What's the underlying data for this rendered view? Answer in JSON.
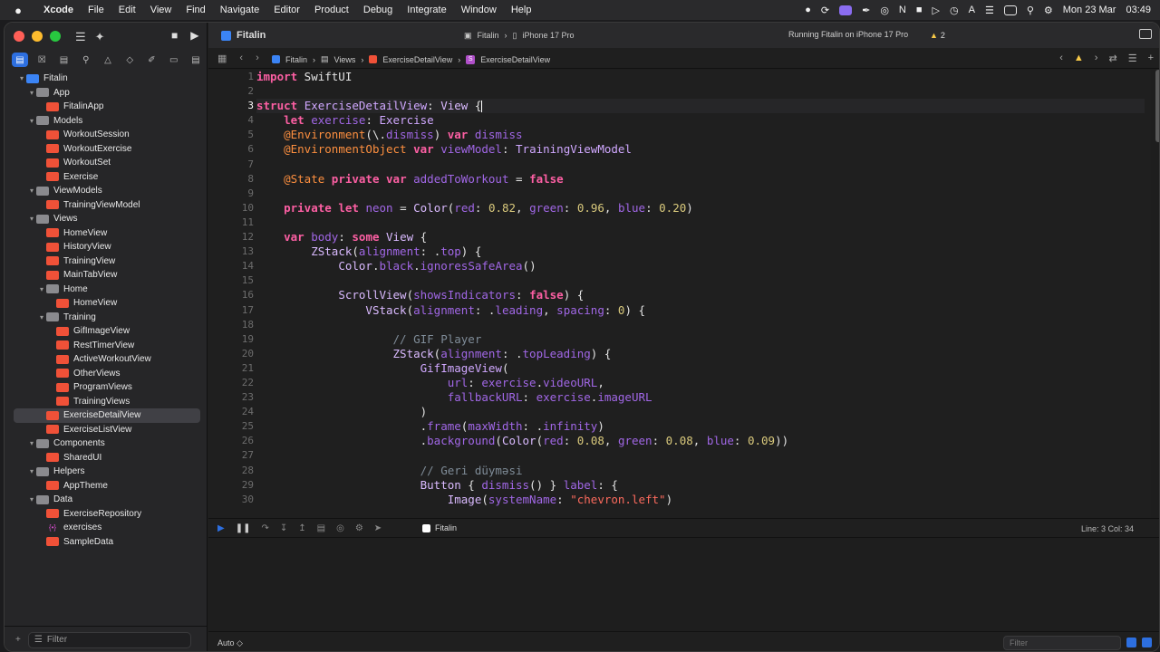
{
  "menubar": {
    "apple": "",
    "app": "Xcode",
    "items": [
      "File",
      "Edit",
      "View",
      "Find",
      "Navigate",
      "Editor",
      "Product",
      "Debug",
      "Integrate",
      "Window",
      "Help"
    ],
    "date": "Mon 23 Mar",
    "time": "03:49"
  },
  "toolbar": {
    "project": "Fitalin",
    "scheme": "Fitalin",
    "device": "iPhone 17 Pro",
    "status": "Running Fitalin on iPhone 17 Pro",
    "warning_count": "2"
  },
  "jumpbar": {
    "crumbs": [
      "Fitalin",
      "Views",
      "ExerciseDetailView",
      "ExerciseDetailView"
    ]
  },
  "navigator": {
    "items": [
      {
        "label": "Fitalin",
        "kind": "proj",
        "depth": 0,
        "chev": "▾"
      },
      {
        "label": "App",
        "kind": "folder",
        "depth": 1,
        "chev": "▾"
      },
      {
        "label": "FitalinApp",
        "kind": "swift",
        "depth": 2,
        "chev": ""
      },
      {
        "label": "Models",
        "kind": "folder",
        "depth": 1,
        "chev": "▾"
      },
      {
        "label": "WorkoutSession",
        "kind": "swift",
        "depth": 2,
        "chev": ""
      },
      {
        "label": "WorkoutExercise",
        "kind": "swift",
        "depth": 2,
        "chev": ""
      },
      {
        "label": "WorkoutSet",
        "kind": "swift",
        "depth": 2,
        "chev": ""
      },
      {
        "label": "Exercise",
        "kind": "swift",
        "depth": 2,
        "chev": ""
      },
      {
        "label": "ViewModels",
        "kind": "folder",
        "depth": 1,
        "chev": "▾"
      },
      {
        "label": "TrainingViewModel",
        "kind": "swift",
        "depth": 2,
        "chev": ""
      },
      {
        "label": "Views",
        "kind": "folder",
        "depth": 1,
        "chev": "▾"
      },
      {
        "label": "HomeView",
        "kind": "swift",
        "depth": 2,
        "chev": ""
      },
      {
        "label": "HistoryView",
        "kind": "swift",
        "depth": 2,
        "chev": ""
      },
      {
        "label": "TrainingView",
        "kind": "swift",
        "depth": 2,
        "chev": ""
      },
      {
        "label": "MainTabView",
        "kind": "swift",
        "depth": 2,
        "chev": ""
      },
      {
        "label": "Home",
        "kind": "folder",
        "depth": 2,
        "chev": "▾"
      },
      {
        "label": "HomeView",
        "kind": "swift",
        "depth": 3,
        "chev": ""
      },
      {
        "label": "Training",
        "kind": "folder",
        "depth": 2,
        "chev": "▾"
      },
      {
        "label": "GifImageView",
        "kind": "swift",
        "depth": 3,
        "chev": ""
      },
      {
        "label": "RestTimerView",
        "kind": "swift",
        "depth": 3,
        "chev": ""
      },
      {
        "label": "ActiveWorkoutView",
        "kind": "swift",
        "depth": 3,
        "chev": ""
      },
      {
        "label": "OtherViews",
        "kind": "swift",
        "depth": 3,
        "chev": ""
      },
      {
        "label": "ProgramViews",
        "kind": "swift",
        "depth": 3,
        "chev": ""
      },
      {
        "label": "TrainingViews",
        "kind": "swift",
        "depth": 3,
        "chev": ""
      },
      {
        "label": "ExerciseDetailView",
        "kind": "swift",
        "depth": 2,
        "chev": "",
        "selected": true
      },
      {
        "label": "ExerciseListView",
        "kind": "swift",
        "depth": 2,
        "chev": ""
      },
      {
        "label": "Components",
        "kind": "folder",
        "depth": 1,
        "chev": "▾"
      },
      {
        "label": "SharedUI",
        "kind": "swift",
        "depth": 2,
        "chev": ""
      },
      {
        "label": "Helpers",
        "kind": "folder",
        "depth": 1,
        "chev": "▾"
      },
      {
        "label": "AppTheme",
        "kind": "swift",
        "depth": 2,
        "chev": ""
      },
      {
        "label": "Data",
        "kind": "folder",
        "depth": 1,
        "chev": "▾"
      },
      {
        "label": "ExerciseRepository",
        "kind": "swift",
        "depth": 2,
        "chev": ""
      },
      {
        "label": "exercises",
        "kind": "json",
        "depth": 2,
        "chev": ""
      },
      {
        "label": "SampleData",
        "kind": "swift",
        "depth": 2,
        "chev": ""
      }
    ],
    "filter_placeholder": "Filter"
  },
  "editor": {
    "current_line": 3,
    "lines": [
      [
        [
          "kw",
          "import"
        ],
        [
          "t",
          " SwiftUI"
        ]
      ],
      [],
      [
        [
          "kw",
          "struct"
        ],
        [
          "t",
          " "
        ],
        [
          "ty",
          "ExerciseDetailView"
        ],
        [
          "t",
          ": "
        ],
        [
          "pt",
          "View"
        ],
        [
          "t",
          " {"
        ]
      ],
      [
        [
          "t",
          "    "
        ],
        [
          "kw",
          "let"
        ],
        [
          "t",
          " "
        ],
        [
          "pr",
          "exercise"
        ],
        [
          "t",
          ": "
        ],
        [
          "ty",
          "Exercise"
        ]
      ],
      [
        [
          "t",
          "    "
        ],
        [
          "at",
          "@Environment"
        ],
        [
          "t",
          "(\\."
        ],
        [
          "pr",
          "dismiss"
        ],
        [
          "t",
          ") "
        ],
        [
          "kw",
          "var"
        ],
        [
          "t",
          " "
        ],
        [
          "pr",
          "dismiss"
        ]
      ],
      [
        [
          "t",
          "    "
        ],
        [
          "at",
          "@EnvironmentObject"
        ],
        [
          "t",
          " "
        ],
        [
          "kw",
          "var"
        ],
        [
          "t",
          " "
        ],
        [
          "pr",
          "viewModel"
        ],
        [
          "t",
          ": "
        ],
        [
          "ty",
          "TrainingViewModel"
        ]
      ],
      [],
      [
        [
          "t",
          "    "
        ],
        [
          "at",
          "@State"
        ],
        [
          "t",
          " "
        ],
        [
          "kw",
          "private"
        ],
        [
          "t",
          " "
        ],
        [
          "kw",
          "var"
        ],
        [
          "t",
          " "
        ],
        [
          "pr",
          "addedToWorkout"
        ],
        [
          "t",
          " = "
        ],
        [
          "kw",
          "false"
        ]
      ],
      [],
      [
        [
          "t",
          "    "
        ],
        [
          "kw",
          "private"
        ],
        [
          "t",
          " "
        ],
        [
          "kw",
          "let"
        ],
        [
          "t",
          " "
        ],
        [
          "pr",
          "neon"
        ],
        [
          "t",
          " = "
        ],
        [
          "pt",
          "Color"
        ],
        [
          "t",
          "("
        ],
        [
          "pr",
          "red"
        ],
        [
          "t",
          ": "
        ],
        [
          "nu",
          "0.82"
        ],
        [
          "t",
          ", "
        ],
        [
          "pr",
          "green"
        ],
        [
          "t",
          ": "
        ],
        [
          "nu",
          "0.96"
        ],
        [
          "t",
          ", "
        ],
        [
          "pr",
          "blue"
        ],
        [
          "t",
          ": "
        ],
        [
          "nu",
          "0.20"
        ],
        [
          "t",
          ")"
        ]
      ],
      [],
      [
        [
          "t",
          "    "
        ],
        [
          "kw",
          "var"
        ],
        [
          "t",
          " "
        ],
        [
          "pr",
          "body"
        ],
        [
          "t",
          ": "
        ],
        [
          "kw",
          "some"
        ],
        [
          "t",
          " "
        ],
        [
          "pt",
          "View"
        ],
        [
          "t",
          " {"
        ]
      ],
      [
        [
          "t",
          "        "
        ],
        [
          "pt",
          "ZStack"
        ],
        [
          "t",
          "("
        ],
        [
          "pr",
          "alignment"
        ],
        [
          "t",
          ": ."
        ],
        [
          "pr",
          "top"
        ],
        [
          "t",
          ") {"
        ]
      ],
      [
        [
          "t",
          "            "
        ],
        [
          "pt",
          "Color"
        ],
        [
          "t",
          "."
        ],
        [
          "pr",
          "black"
        ],
        [
          "t",
          "."
        ],
        [
          "pr",
          "ignoresSafeArea"
        ],
        [
          "t",
          "()"
        ]
      ],
      [],
      [
        [
          "t",
          "            "
        ],
        [
          "pt",
          "ScrollView"
        ],
        [
          "t",
          "("
        ],
        [
          "pr",
          "showsIndicators"
        ],
        [
          "t",
          ": "
        ],
        [
          "kw",
          "false"
        ],
        [
          "t",
          ") {"
        ]
      ],
      [
        [
          "t",
          "                "
        ],
        [
          "pt",
          "VStack"
        ],
        [
          "t",
          "("
        ],
        [
          "pr",
          "alignment"
        ],
        [
          "t",
          ": ."
        ],
        [
          "pr",
          "leading"
        ],
        [
          "t",
          ", "
        ],
        [
          "pr",
          "spacing"
        ],
        [
          "t",
          ": "
        ],
        [
          "nu",
          "0"
        ],
        [
          "t",
          ") {"
        ]
      ],
      [],
      [
        [
          "t",
          "                    "
        ],
        [
          "cm",
          "// GIF Player"
        ]
      ],
      [
        [
          "t",
          "                    "
        ],
        [
          "pt",
          "ZStack"
        ],
        [
          "t",
          "("
        ],
        [
          "pr",
          "alignment"
        ],
        [
          "t",
          ": ."
        ],
        [
          "pr",
          "topLeading"
        ],
        [
          "t",
          ") {"
        ]
      ],
      [
        [
          "t",
          "                        "
        ],
        [
          "ty",
          "GifImageView"
        ],
        [
          "t",
          "("
        ]
      ],
      [
        [
          "t",
          "                            "
        ],
        [
          "pr",
          "url"
        ],
        [
          "t",
          ": "
        ],
        [
          "pr",
          "exercise"
        ],
        [
          "t",
          "."
        ],
        [
          "pr",
          "videoURL"
        ],
        [
          "t",
          ","
        ]
      ],
      [
        [
          "t",
          "                            "
        ],
        [
          "pr",
          "fallbackURL"
        ],
        [
          "t",
          ": "
        ],
        [
          "pr",
          "exercise"
        ],
        [
          "t",
          "."
        ],
        [
          "pr",
          "imageURL"
        ]
      ],
      [
        [
          "t",
          "                        )"
        ]
      ],
      [
        [
          "t",
          "                        ."
        ],
        [
          "pr",
          "frame"
        ],
        [
          "t",
          "("
        ],
        [
          "pr",
          "maxWidth"
        ],
        [
          "t",
          ": ."
        ],
        [
          "pr",
          "infinity"
        ],
        [
          "t",
          ")"
        ]
      ],
      [
        [
          "t",
          "                        ."
        ],
        [
          "pr",
          "background"
        ],
        [
          "t",
          "("
        ],
        [
          "pt",
          "Color"
        ],
        [
          "t",
          "("
        ],
        [
          "pr",
          "red"
        ],
        [
          "t",
          ": "
        ],
        [
          "nu",
          "0.08"
        ],
        [
          "t",
          ", "
        ],
        [
          "pr",
          "green"
        ],
        [
          "t",
          ": "
        ],
        [
          "nu",
          "0.08"
        ],
        [
          "t",
          ", "
        ],
        [
          "pr",
          "blue"
        ],
        [
          "t",
          ": "
        ],
        [
          "nu",
          "0.09"
        ],
        [
          "t",
          "))"
        ]
      ],
      [],
      [
        [
          "t",
          "                        "
        ],
        [
          "cm",
          "// Geri düyməsi"
        ]
      ],
      [
        [
          "t",
          "                        "
        ],
        [
          "pt",
          "Button"
        ],
        [
          "t",
          " { "
        ],
        [
          "pr",
          "dismiss"
        ],
        [
          "t",
          "() } "
        ],
        [
          "pr",
          "label"
        ],
        [
          "t",
          ": {"
        ]
      ],
      [
        [
          "t",
          "                            "
        ],
        [
          "pt",
          "Image"
        ],
        [
          "t",
          "("
        ],
        [
          "pr",
          "systemName"
        ],
        [
          "t",
          ": "
        ],
        [
          "st",
          "\"chevron.left\""
        ],
        [
          "t",
          ")"
        ]
      ]
    ]
  },
  "debug": {
    "target": "Fitalin",
    "position": "Line: 3  Col: 34"
  },
  "bottombar": {
    "auto": "Auto ◇",
    "filter_placeholder": "Filter"
  },
  "colors": {
    "accent": "#2d6fe0",
    "keyword": "#fc5fa3",
    "string": "#fc6a5d",
    "number": "#d9c97c",
    "comment": "#7f8c98"
  }
}
